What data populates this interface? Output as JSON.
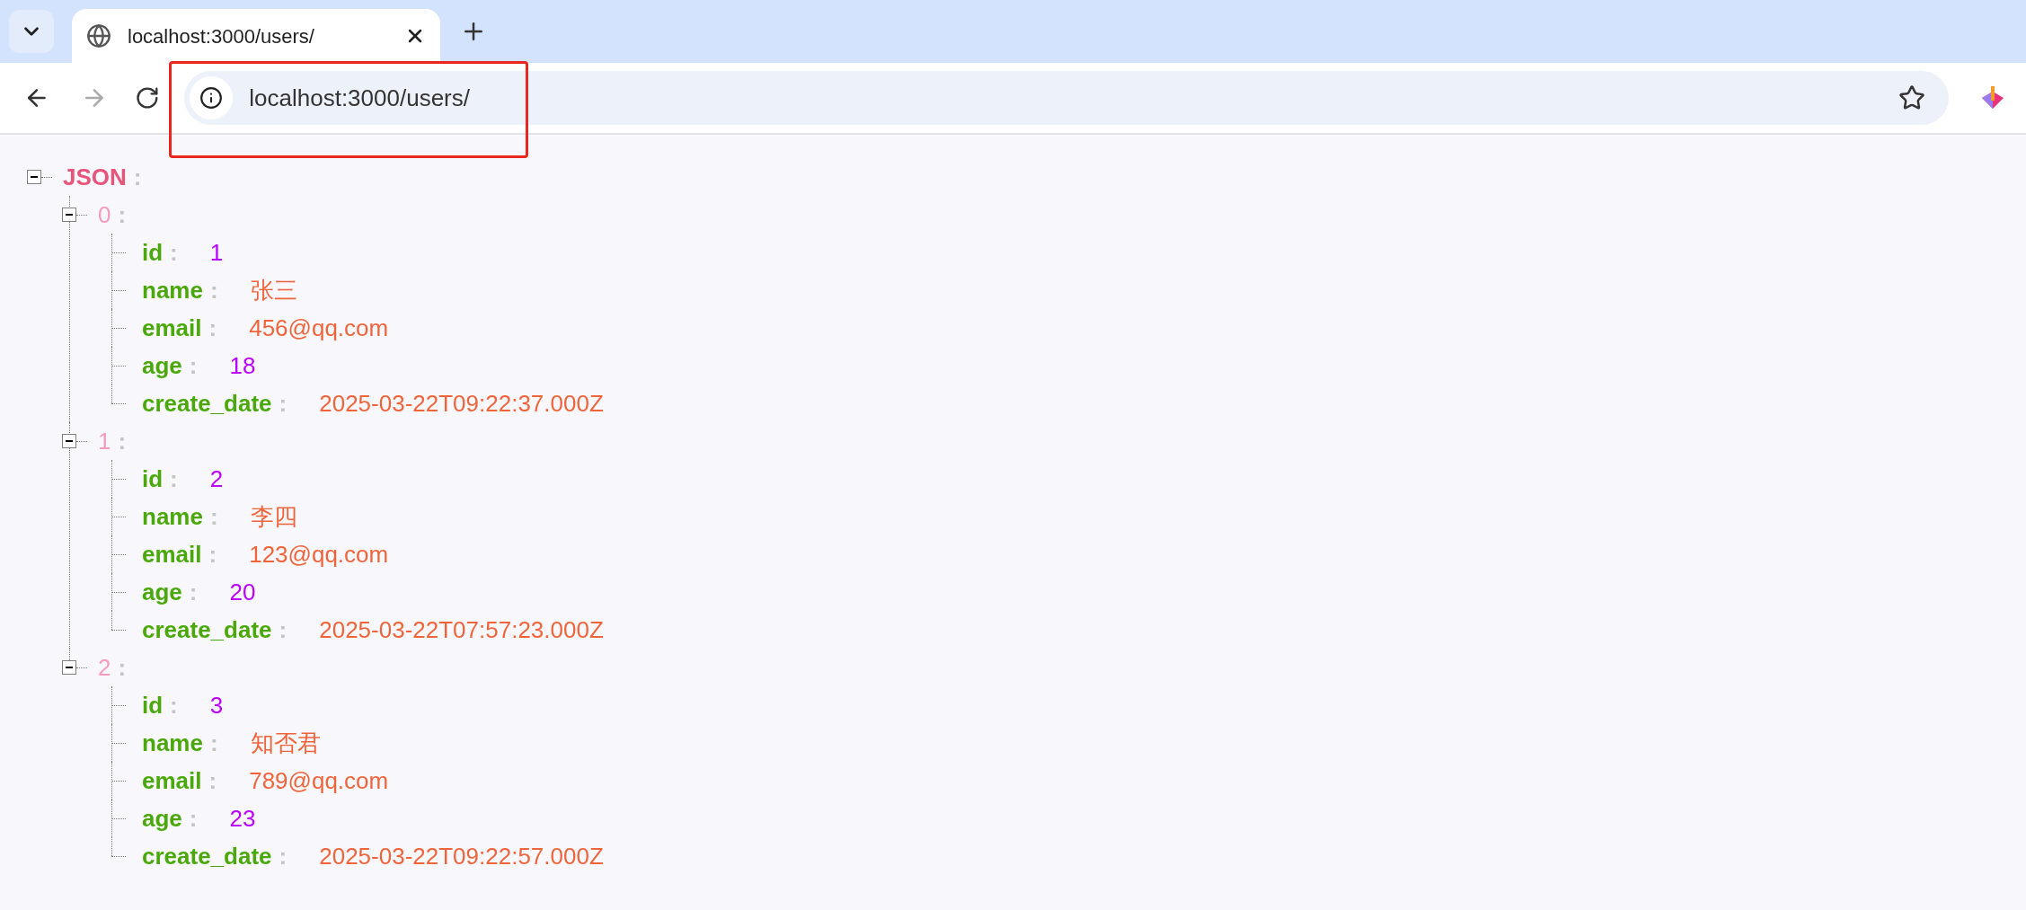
{
  "browser": {
    "tabs": [
      {
        "title": "localhost:3000/users/",
        "selected": true
      }
    ],
    "forward_enabled": false,
    "address": "localhost:3000/users/",
    "bookmarked": false,
    "address_highlighted": true
  },
  "tree": {
    "key": "JSON",
    "colon": ":",
    "expanded": true,
    "children": [
      {
        "key": "0",
        "colon": ":",
        "expanded": true,
        "children": [
          {
            "key": "id",
            "colon": ":",
            "kind": "number",
            "value": "1"
          },
          {
            "key": "name",
            "colon": ":",
            "kind": "string",
            "value": "张三"
          },
          {
            "key": "email",
            "colon": ":",
            "kind": "string",
            "value": "456@qq.com"
          },
          {
            "key": "age",
            "colon": ":",
            "kind": "number",
            "value": "18"
          },
          {
            "key": "create_date",
            "colon": ":",
            "kind": "string",
            "value": "2025-03-22T09:22:37.000Z"
          }
        ]
      },
      {
        "key": "1",
        "colon": ":",
        "expanded": true,
        "children": [
          {
            "key": "id",
            "colon": ":",
            "kind": "number",
            "value": "2"
          },
          {
            "key": "name",
            "colon": ":",
            "kind": "string",
            "value": "李四"
          },
          {
            "key": "email",
            "colon": ":",
            "kind": "string",
            "value": "123@qq.com"
          },
          {
            "key": "age",
            "colon": ":",
            "kind": "number",
            "value": "20"
          },
          {
            "key": "create_date",
            "colon": ":",
            "kind": "string",
            "value": "2025-03-22T07:57:23.000Z"
          }
        ]
      },
      {
        "key": "2",
        "colon": ":",
        "expanded": true,
        "children": [
          {
            "key": "id",
            "colon": ":",
            "kind": "number",
            "value": "3"
          },
          {
            "key": "name",
            "colon": ":",
            "kind": "string",
            "value": "知否君"
          },
          {
            "key": "email",
            "colon": ":",
            "kind": "string",
            "value": "789@qq.com"
          },
          {
            "key": "age",
            "colon": ":",
            "kind": "number",
            "value": "23"
          },
          {
            "key": "create_date",
            "colon": ":",
            "kind": "string",
            "value": "2025-03-22T09:22:57.000Z"
          }
        ]
      }
    ]
  }
}
